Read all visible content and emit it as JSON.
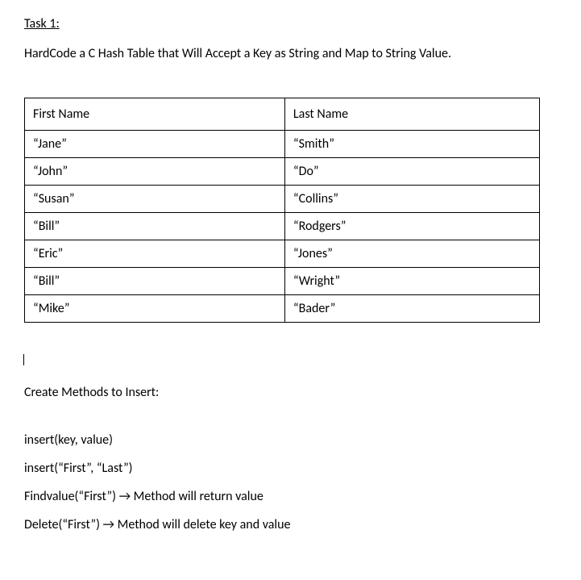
{
  "heading": "Task 1:",
  "description": "HardCode a C Hash Table that Will Accept a Key as String and Map to String Value.",
  "table": {
    "headers": [
      "First Name",
      "Last Name"
    ],
    "rows": [
      [
        "“Jane”",
        "“Smith”"
      ],
      [
        "“John”",
        "“Do”"
      ],
      [
        "“Susan”",
        "“Collins”"
      ],
      [
        "“Bill”",
        "“Rodgers”"
      ],
      [
        "“Eric”",
        "“Jones”"
      ],
      [
        "“Bill”",
        "“Wright”"
      ],
      [
        "“Mike”",
        "“Bader”"
      ]
    ]
  },
  "methodsHeading": "Create Methods to Insert:",
  "methods": [
    "insert(key, value)",
    "insert(“First”, “Last”)",
    "Findvalue(“First”) → Method will return value",
    "Delete(“First”) → Method will delete key and value"
  ]
}
